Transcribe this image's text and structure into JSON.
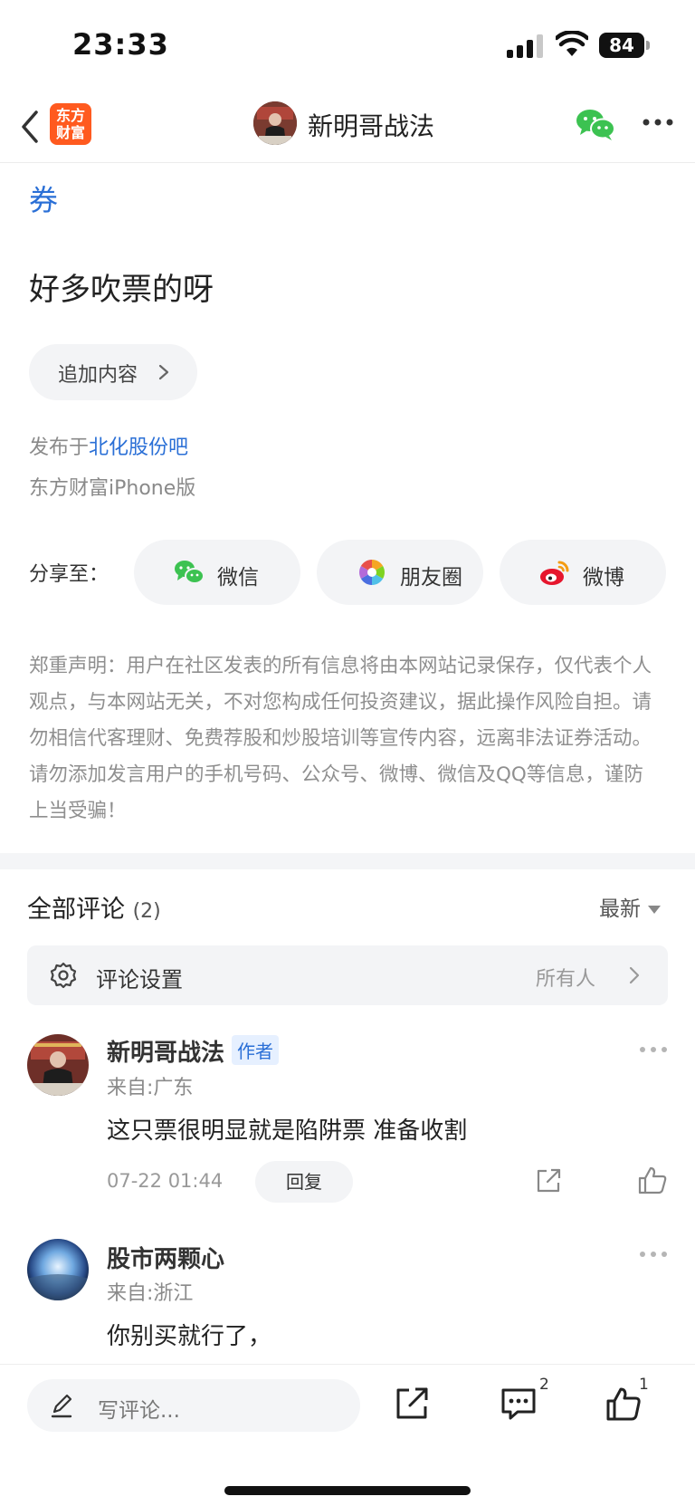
{
  "status_bar": {
    "time": "23:33",
    "battery": "84"
  },
  "nav": {
    "app_logo_line1": "东方",
    "app_logo_line2": "财富",
    "title": "新明哥战法"
  },
  "article": {
    "cut_link_text": "券",
    "body": "好多吹票的呀",
    "append_label": "追加内容",
    "published_prefix": "发布于",
    "published_bar": "北化股份吧",
    "platform": "东方财富iPhone版",
    "share_label": "分享至：",
    "share_targets": [
      {
        "label": "微信",
        "icon": "wechat-icon"
      },
      {
        "label": "朋友圈",
        "icon": "moments-icon"
      },
      {
        "label": "微博",
        "icon": "weibo-icon"
      }
    ],
    "disclaimer": "郑重声明：用户在社区发表的所有信息将由本网站记录保存，仅代表个人观点，与本网站无关，不对您构成任何投资建议，据此操作风险自担。请勿相信代客理财、免费荐股和炒股培训等宣传内容，远离非法证券活动。请勿添加发言用户的手机号码、公众号、微博、微信及QQ等信息，谨防上当受骗！"
  },
  "comments": {
    "heading": "全部评论",
    "count": "(2)",
    "sort": "最新",
    "settings_label": "评论设置",
    "settings_value": "所有人",
    "items": [
      {
        "name": "新明哥战法",
        "badge": "作者",
        "from": "来自:广东",
        "text": "这只票很明显就是陷阱票 准备收割",
        "time": "07-22 01:44",
        "reply": "回复"
      },
      {
        "name": "股市两颗心",
        "from": "来自:浙江",
        "text": "你别买就行了，"
      }
    ]
  },
  "bottom_bar": {
    "compose_placeholder": "写评论...",
    "comment_count": "2",
    "like_count": "1"
  },
  "colors": {
    "link_blue": "#2a6fd6",
    "brand_orange": "#ff5a1f",
    "wechat_green": "#3cc251"
  }
}
